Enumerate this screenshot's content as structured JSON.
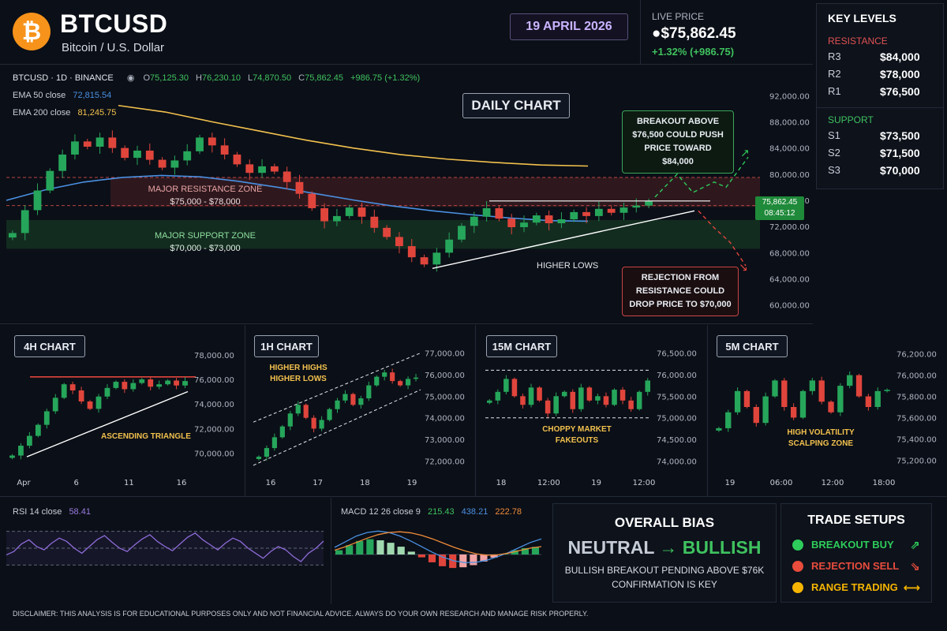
{
  "header": {
    "symbol": "BTCUSD",
    "subtitle": "Bitcoin / U.S. Dollar",
    "date": "19 APRIL 2026",
    "live_label": "LIVE PRICE",
    "live_price": "●$75,862.45",
    "live_change": "+1.32% (+986.75)"
  },
  "key_levels": {
    "title": "KEY LEVELS",
    "resistance_label": "RESISTANCE",
    "resistance": [
      {
        "name": "R3",
        "value": "$84,000"
      },
      {
        "name": "R2",
        "value": "$78,000"
      },
      {
        "name": "R1",
        "value": "$76,500"
      }
    ],
    "support_label": "SUPPORT",
    "support": [
      {
        "name": "S1",
        "value": "$73,500"
      },
      {
        "name": "S2",
        "value": "$71,500"
      },
      {
        "name": "S3",
        "value": "$70,000"
      }
    ]
  },
  "daily": {
    "info": "BTCUSD · 1D · BINANCE",
    "o": "75,125.30",
    "h": "76,230.10",
    "l": "74,870.50",
    "c": "75,862.45",
    "chg": "+986.75 (+1.32%)",
    "ema50_label": "EMA 50 close",
    "ema50_value": "72,815.54",
    "ema200_label": "EMA 200 close",
    "ema200_value": "81,245.75",
    "title": "DAILY CHART",
    "res_zone": "MAJOR RESISTANCE ZONE",
    "res_range": "$75,000 - $78,000",
    "sup_zone": "MAJOR SUPPORT ZONE",
    "sup_range": "$70,000 - $73,000",
    "higher_lows": "HIGHER LOWS",
    "breakout": [
      "BREAKOUT ABOVE",
      "$76,500 COULD PUSH",
      "PRICE TOWARD $84,000"
    ],
    "rejection": [
      "REJECTION FROM",
      "RESISTANCE COULD",
      "DROP PRICE TO $70,000"
    ],
    "price_tag": "75,862.45",
    "time_tag": "08:45:12"
  },
  "chart_data": [
    {
      "id": "daily",
      "type": "candlestick",
      "title": "DAILY CHART",
      "y_ticks": [
        "92,000.00",
        "88,000.00",
        "84,000.00",
        "80,000.00",
        "76,000.00",
        "72,000.00",
        "68,000.00",
        "64,000.00",
        "60,000.00"
      ],
      "ylim": [
        59000,
        93000
      ],
      "series": [
        {
          "name": "EMA 50 close",
          "color": "#4a90e2",
          "values": [
            76000,
            77600,
            78800,
            79500,
            79800,
            79600,
            78900,
            78000,
            77000,
            76000,
            75100,
            74400,
            73800,
            73300,
            72900,
            72815
          ]
        },
        {
          "name": "EMA 200 close",
          "color": "#f2c14e",
          "values": [
            90500,
            89500,
            88000,
            86600,
            85200,
            84000,
            83000,
            82300,
            81800,
            81400,
            81245
          ]
        }
      ],
      "close": [
        71000,
        74500,
        77500,
        80500,
        83000,
        85000,
        84200,
        85600,
        84000,
        82500,
        83600,
        82200,
        81000,
        82100,
        83500,
        85600,
        84400,
        83000,
        81500,
        80200,
        81200,
        80400,
        78800,
        77000,
        74800,
        72800,
        73600,
        74900,
        73500,
        71800,
        70400,
        69000,
        67300,
        66200,
        68000,
        70000,
        72100,
        73500,
        74800,
        73200,
        71900,
        72600,
        73700,
        72500,
        73100,
        74200,
        73600,
        74700,
        74100,
        74900,
        75200,
        75862.45
      ]
    },
    {
      "id": "4h",
      "type": "candlestick",
      "title": "4H CHART",
      "y_ticks": [
        "78,000.00",
        "76,000.00",
        "74,000.00",
        "72,000.00",
        "70,000.00"
      ],
      "x_ticks": [
        "Apr",
        "6",
        "11",
        "16"
      ],
      "ylim": [
        69000,
        78500
      ],
      "annotation": "ASCENDING TRIANGLE",
      "close": [
        69800,
        70600,
        71400,
        72300,
        73400,
        74500,
        75600,
        75100,
        74200,
        73600,
        74600,
        75300,
        75800,
        75200,
        75700,
        76000,
        75400,
        75600,
        75900,
        75500,
        75862
      ]
    },
    {
      "id": "1h",
      "type": "candlestick",
      "title": "1H CHART",
      "y_ticks": [
        "77,000.00",
        "76,000.00",
        "75,000.00",
        "74,000.00",
        "73,000.00",
        "72,000.00"
      ],
      "x_ticks": [
        "16",
        "17",
        "18",
        "19"
      ],
      "ylim": [
        71800,
        77200
      ],
      "annotation": [
        "HIGHER HIGHS",
        "HIGHER LOWS"
      ],
      "close": [
        72200,
        72600,
        73100,
        73600,
        74200,
        74600,
        74000,
        73500,
        73900,
        74400,
        74800,
        75100,
        74600,
        74900,
        75500,
        75900,
        76100,
        75700,
        75500,
        75800,
        75862
      ]
    },
    {
      "id": "15m",
      "type": "candlestick",
      "title": "15M CHART",
      "y_ticks": [
        "76,500.00",
        "76,000.00",
        "75,500.00",
        "75,000.00",
        "74,500.00",
        "74,000.00"
      ],
      "x_ticks": [
        "18",
        "12:00",
        "19",
        "12:00"
      ],
      "ylim": [
        73900,
        76600
      ],
      "annotation": [
        "CHOPPY MARKET",
        "FAKEOUTS"
      ],
      "close": [
        75400,
        75600,
        75900,
        75500,
        75300,
        75700,
        75400,
        75100,
        75500,
        75600,
        75200,
        75700,
        75400,
        75500,
        75300,
        75650,
        75400,
        75200,
        75600,
        75862
      ]
    },
    {
      "id": "5m",
      "type": "candlestick",
      "title": "5M CHART",
      "y_ticks": [
        "76,200.00",
        "76,000.00",
        "75,800.00",
        "75,600.00",
        "75,400.00",
        "75,200.00"
      ],
      "x_ticks": [
        "19",
        "06:00",
        "12:00",
        "18:00"
      ],
      "ylim": [
        75150,
        76250
      ],
      "annotation": [
        "HIGH VOLATILITY",
        "SCALPING ZONE"
      ],
      "close": [
        75500,
        75650,
        75850,
        75700,
        75550,
        75800,
        75950,
        75700,
        75600,
        75850,
        75950,
        75750,
        75650,
        75900,
        76000,
        75800,
        75700,
        75850,
        75862
      ]
    },
    {
      "id": "rsi",
      "type": "line",
      "title": "RSI 14 close",
      "series": [
        {
          "name": "RSI 14 close",
          "color": "#8e6bd8",
          "values": [
            42,
            46,
            55,
            60,
            52,
            48,
            56,
            62,
            58,
            50,
            44,
            52,
            60,
            65,
            57,
            50,
            46,
            54,
            61,
            66,
            58,
            52,
            47,
            55,
            63,
            68,
            60,
            54,
            48,
            56,
            62,
            58,
            50,
            44,
            38,
            46,
            52,
            48,
            40,
            34,
            44,
            50,
            58.41
          ]
        }
      ]
    },
    {
      "id": "macd",
      "type": "bar+line",
      "title": "MACD 12 26 close 9",
      "series": [
        {
          "name": "215.43",
          "color": "#3aa55b",
          "values": [
            120,
            260,
            380,
            430,
            400,
            330,
            220,
            80,
            -80,
            -220,
            -330,
            -380,
            -360,
            -300,
            -200,
            -90,
            20,
            120,
            180,
            215
          ]
        },
        {
          "name": "438.21",
          "color": "#4a90e2",
          "values": [
            200,
            360,
            520,
            620,
            660,
            620,
            520,
            380,
            220,
            60,
            -80,
            -180,
            -230,
            -220,
            -160,
            -60,
            60,
            200,
            340,
            438
          ]
        },
        {
          "name": "222.78",
          "color": "#f08c3a",
          "values": [
            120,
            220,
            340,
            460,
            560,
            620,
            640,
            610,
            540,
            440,
            320,
            200,
            100,
            20,
            -20,
            -10,
            40,
            110,
            180,
            223
          ]
        }
      ]
    }
  ],
  "panels": {
    "h4": {
      "title": "4H CHART",
      "annotation": "ASCENDING TRIANGLE"
    },
    "h1": {
      "title": "1H CHART",
      "ann1": "HIGHER HIGHS",
      "ann2": "HIGHER LOWS"
    },
    "m15": {
      "title": "15M CHART",
      "ann1": "CHOPPY MARKET",
      "ann2": "FAKEOUTS"
    },
    "m5": {
      "title": "5M CHART",
      "ann1": "HIGH VOLATILITY",
      "ann2": "SCALPING ZONE"
    },
    "rsi": {
      "label": "RSI 14 close",
      "value": "58.41"
    },
    "macd": {
      "label": "MACD 12 26 close 9",
      "v1": "215.43",
      "v2": "438.21",
      "v3": "222.78"
    }
  },
  "bias": {
    "title": "OVERALL BIAS",
    "from": "NEUTRAL",
    "arrow": "→",
    "to": "BULLISH",
    "line1": "BULLISH BREAKOUT PENDING ABOVE $76K",
    "line2": "CONFIRMATION IS KEY"
  },
  "setups": {
    "title": "TRADE SETUPS",
    "items": [
      {
        "label": "BREAKOUT BUY",
        "color": "#2ecc5a",
        "arrow": "⇗"
      },
      {
        "label": "REJECTION SELL",
        "color": "#e74c3c",
        "arrow": "⇘"
      },
      {
        "label": "RANGE TRADING",
        "color": "#f5b400",
        "arrow": "⟷"
      }
    ]
  },
  "disclaimer": "DISCLAIMER: THIS ANALYSIS IS FOR EDUCATIONAL PURPOSES ONLY AND NOT FINANCIAL ADVICE. ALWAYS DO YOUR OWN RESEARCH AND MANAGE RISK PROPERLY."
}
